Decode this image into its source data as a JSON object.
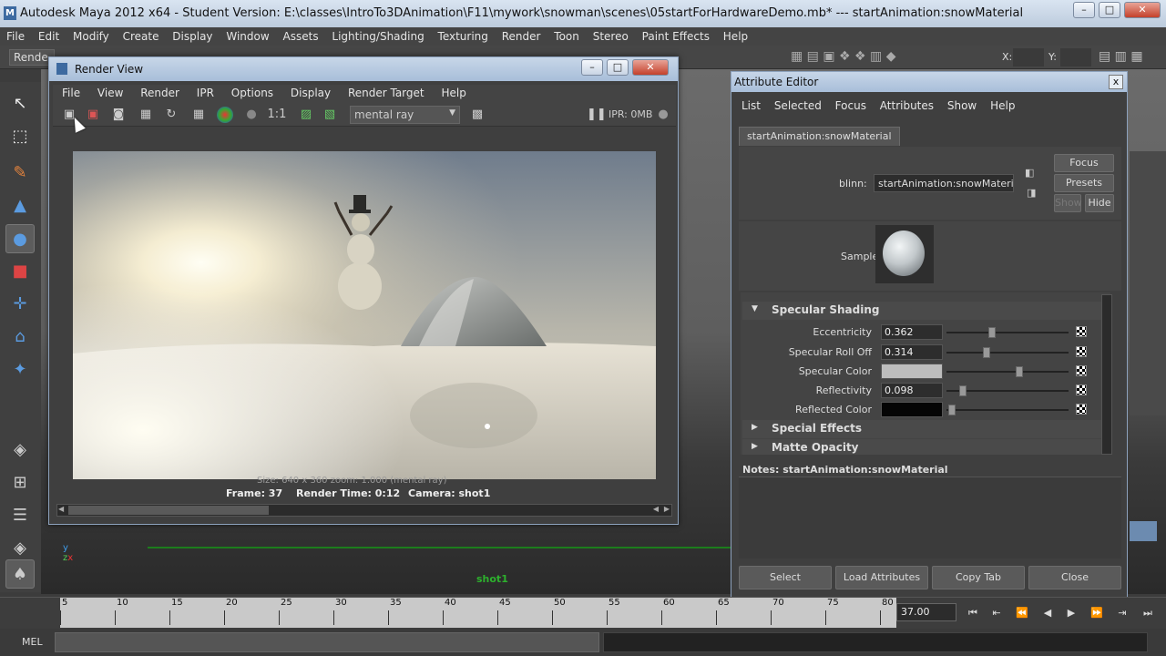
{
  "window": {
    "title": "Autodesk Maya 2012 x64 - Student Version: E:\\classes\\IntroTo3DAnimation\\F11\\mywork\\snowman\\scenes\\05startForHardwareDemo.mb*   ---   startAnimation:snowMaterial",
    "minimize": "–",
    "maximize": "□",
    "close": "✕"
  },
  "main_menu": [
    "File",
    "Edit",
    "Modify",
    "Create",
    "Display",
    "Window",
    "Assets",
    "Lighting/Shading",
    "Texturing",
    "Render",
    "Toon",
    "Stereo",
    "Paint Effects",
    "Help"
  ],
  "shelf": {
    "mode": "Rende",
    "x_label": "X:",
    "y_label": "Y:"
  },
  "toolbox": {
    "tools": [
      "select-tool",
      "lasso-tool",
      "paint-tool",
      "move-tool",
      "rotate-tool",
      "scale-tool",
      "manipulator-tool",
      "soft-mod-tool",
      "last-tool"
    ]
  },
  "viewport": {
    "camera_label": "shot1"
  },
  "render_view": {
    "title": "Render View",
    "menu": [
      "File",
      "View",
      "Render",
      "IPR",
      "Options",
      "Display",
      "Render Target",
      "Help"
    ],
    "renderer": "mental ray",
    "ratio": "1:1",
    "ipr": "IPR: 0MB",
    "size_info": "Size: 640 x 360  zoom: 1.000      (mental ray)",
    "frame": "Frame: 37",
    "render_time": "Render Time: 0:12",
    "camera": "Camera: shot1"
  },
  "attribute_editor": {
    "title": "Attribute Editor",
    "close": "x",
    "menu": [
      "List",
      "Selected",
      "Focus",
      "Attributes",
      "Show",
      "Help"
    ],
    "tab": "startAnimation:snowMaterial",
    "type_label": "blinn:",
    "name_value": "startAnimation:snowMaterial",
    "focus_btn": "Focus",
    "presets_btn": "Presets",
    "show_btn": "Show",
    "hide_btn": "Hide",
    "sample_label": "Sample",
    "section_specular": "Specular Shading",
    "attrs": [
      {
        "label": "Eccentricity",
        "value": "0.362"
      },
      {
        "label": "Specular Roll Off",
        "value": "0.314"
      },
      {
        "label": "Specular Color",
        "value": ""
      },
      {
        "label": "Reflectivity",
        "value": "0.098"
      },
      {
        "label": "Reflected Color",
        "value": ""
      }
    ],
    "specular_color": "#bdbdbd",
    "reflected_color": "#050505",
    "section_effects": "Special Effects",
    "section_matte": "Matte Opacity",
    "notes": "Notes:  startAnimation:snowMaterial",
    "footer": [
      "Select",
      "Load Attributes",
      "Copy Tab",
      "Close"
    ]
  },
  "timeline": {
    "ticks": [
      "5",
      "10",
      "15",
      "20",
      "25",
      "30",
      "35",
      "40",
      "45",
      "50",
      "55",
      "60",
      "65",
      "70",
      "75",
      "80"
    ],
    "current_frame": "37.00"
  },
  "command_line": {
    "label": "MEL"
  }
}
